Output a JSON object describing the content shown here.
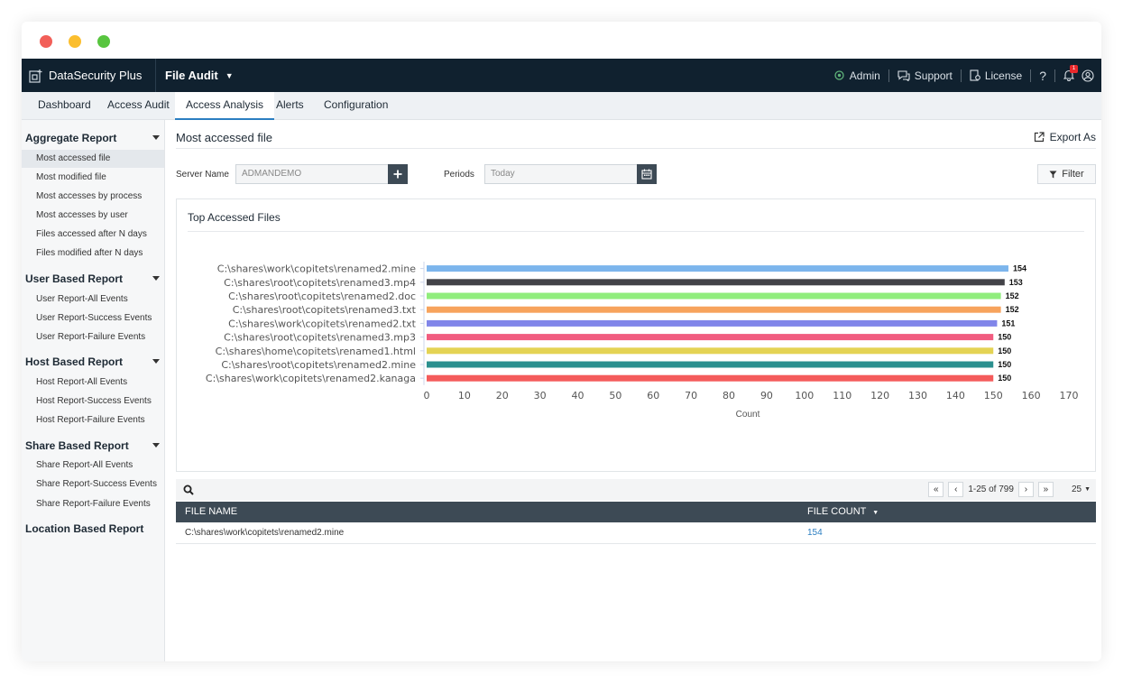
{
  "topbar": {
    "brand": "DataSecurity Plus",
    "module": "File Audit",
    "admin": "Admin",
    "support": "Support",
    "license": "License",
    "help": "?",
    "notification_count": "1"
  },
  "tabs": [
    "Dashboard",
    "Access Audit",
    "Access Analysis",
    "Alerts",
    "Configuration"
  ],
  "sidebar": {
    "groups": [
      {
        "title": "Aggregate Report",
        "items": [
          "Most accessed file",
          "Most modified file",
          "Most accesses by process",
          "Most accesses by user",
          "Files accessed after N days",
          "Files modified after N days"
        ]
      },
      {
        "title": "User Based Report",
        "items": [
          "User Report-All Events",
          "User Report-Success Events",
          "User Report-Failure Events"
        ]
      },
      {
        "title": "Host Based Report",
        "items": [
          "Host Report-All Events",
          "Host Report-Success Events",
          "Host Report-Failure Events"
        ]
      },
      {
        "title": "Share Based Report",
        "items": [
          "Share Report-All Events",
          "Share Report-Success Events",
          "Share Report-Failure Events"
        ]
      },
      {
        "title": "Location Based Report",
        "items": []
      }
    ]
  },
  "main": {
    "title": "Most accessed file",
    "export_label": "Export As",
    "server_label": "Server Name",
    "server_value": "ADMANDEMO",
    "periods_label": "Periods",
    "periods_value": "Today",
    "filter_label": "Filter"
  },
  "chart_data": {
    "type": "bar",
    "orientation": "horizontal",
    "title": "Top Accessed Files",
    "xlabel": "Count",
    "ylabel": "",
    "xlim": [
      0,
      170
    ],
    "xticks": [
      0,
      10,
      20,
      30,
      40,
      50,
      60,
      70,
      80,
      90,
      100,
      110,
      120,
      130,
      140,
      150,
      160,
      170
    ],
    "grid": false,
    "categories": [
      "C:\\shares\\work\\copitets\\renamed2.mine",
      "C:\\shares\\root\\copitets\\renamed3.mp4",
      "C:\\shares\\root\\copitets\\renamed2.doc",
      "C:\\shares\\root\\copitets\\renamed3.txt",
      "C:\\shares\\work\\copitets\\renamed2.txt",
      "C:\\shares\\root\\copitets\\renamed3.mp3",
      "C:\\shares\\home\\copitets\\renamed1.html",
      "C:\\shares\\root\\copitets\\renamed2.mine",
      "C:\\shares\\work\\copitets\\renamed2.kanaga"
    ],
    "values": [
      154,
      153,
      152,
      152,
      151,
      150,
      150,
      150,
      150
    ],
    "colors": [
      "#7cb5ec",
      "#434348",
      "#90ed7d",
      "#f7a35c",
      "#8085e9",
      "#f15c80",
      "#e4d354",
      "#2b908f",
      "#f45b5b"
    ]
  },
  "table": {
    "pager_text": "1-25 of 799",
    "page_size": "25",
    "columns": [
      "FILE NAME",
      "FILE COUNT"
    ],
    "rows": [
      {
        "file_name": "C:\\shares\\work\\copitets\\renamed2.mine",
        "file_count": "154"
      }
    ]
  }
}
